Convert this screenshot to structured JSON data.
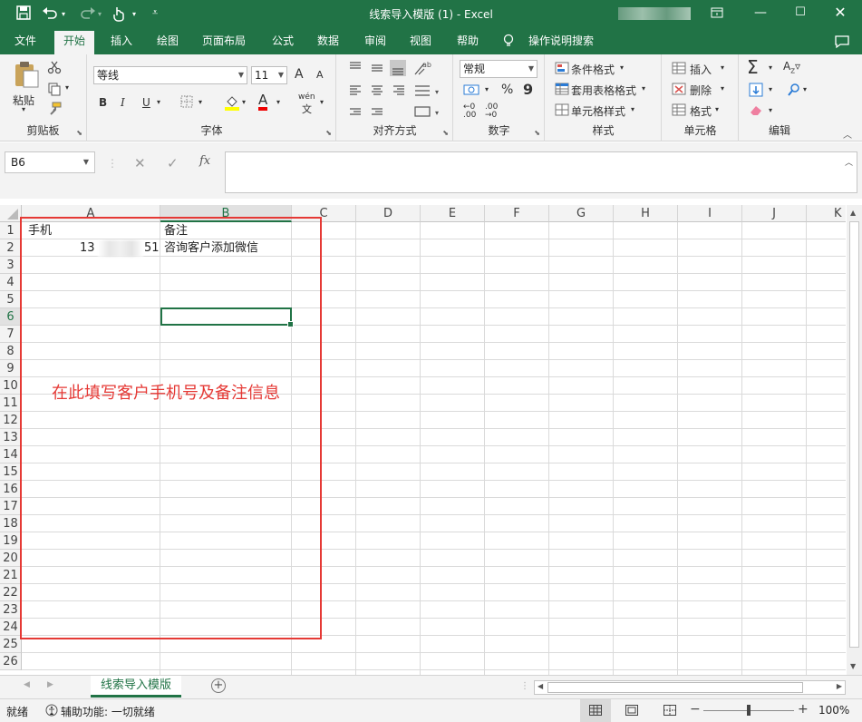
{
  "title": "线索导入模版 (1)  -  Excel",
  "tabs": [
    "文件",
    "开始",
    "插入",
    "绘图",
    "页面布局",
    "公式",
    "数据",
    "审阅",
    "视图",
    "帮助",
    "操作说明搜索"
  ],
  "ribbon": {
    "clipboard": {
      "label": "剪贴板",
      "paste": "粘贴"
    },
    "font": {
      "label": "字体",
      "name": "等线",
      "size": "11",
      "grow": "A",
      "shrink": "A",
      "bold": "B",
      "italic": "I",
      "underline": "U",
      "phonetic": "wén",
      "color_char": "A"
    },
    "alignment": {
      "label": "对齐方式"
    },
    "number": {
      "label": "数字",
      "format": "常规",
      "percent": "%",
      "comma": "9"
    },
    "styles": {
      "label": "样式",
      "conditional": "条件格式",
      "table": "套用表格格式",
      "cell": "单元格样式"
    },
    "cells": {
      "label": "单元格",
      "insert": "插入",
      "delete": "删除",
      "format": "格式"
    },
    "editing": {
      "label": "编辑"
    }
  },
  "formula_bar": {
    "name_box": "B6",
    "fx": "fx",
    "value": ""
  },
  "grid": {
    "columns": [
      "A",
      "B",
      "C",
      "D",
      "E",
      "F",
      "G",
      "H",
      "I",
      "J",
      "K"
    ],
    "rows": [
      "1",
      "2",
      "3",
      "4",
      "5",
      "6",
      "7",
      "8",
      "9",
      "10",
      "11",
      "12",
      "13",
      "14",
      "15",
      "16",
      "17",
      "18",
      "19",
      "20",
      "21",
      "22",
      "23",
      "24",
      "25",
      "26"
    ],
    "a1": "手机",
    "b1": "备注",
    "a2_prefix": "13",
    "a2_suffix": "51",
    "b2": "咨询客户添加微信"
  },
  "annotation": "在此填写客户手机号及备注信息",
  "sheet_tab": "线索导入模版",
  "status": {
    "ready": "就绪",
    "accessibility": "辅助功能: 一切就绪",
    "zoom": "100%"
  },
  "colors": {
    "excel_green": "#217346",
    "annotation_red": "#e53935"
  }
}
